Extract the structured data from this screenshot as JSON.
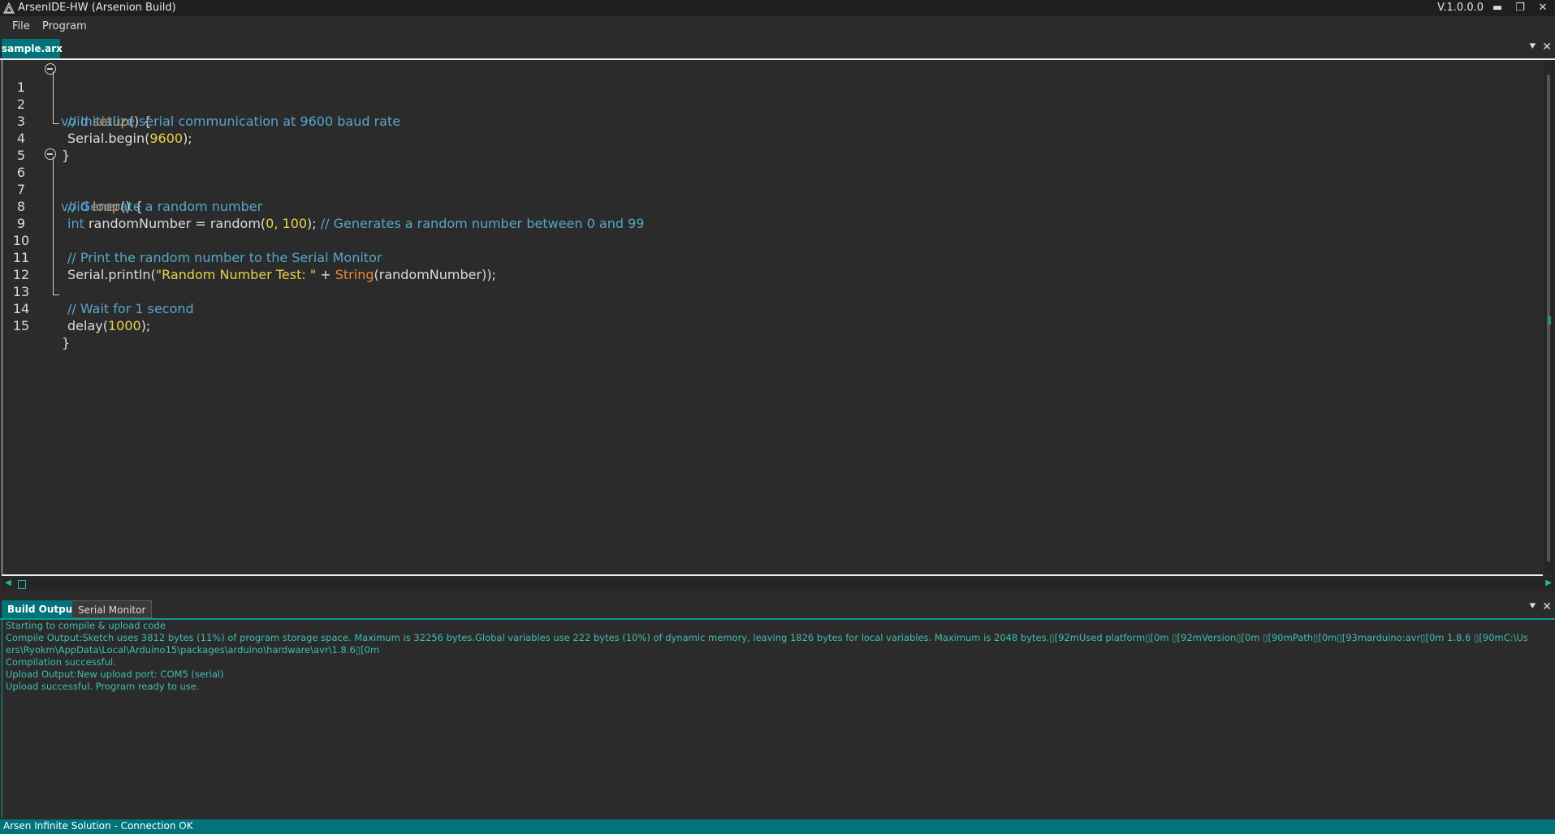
{
  "window": {
    "title": "ArsenIDE-HW (Arsenion Build)",
    "version": "V.1.0.0.0",
    "controls": {
      "minimize": "▬",
      "restore": "❐",
      "close": "✕"
    }
  },
  "menu": {
    "items": [
      {
        "label": "File"
      },
      {
        "label": "Program"
      }
    ]
  },
  "editor": {
    "tab_label": "sample.arx",
    "line_numbers": [
      "1",
      "2",
      "3",
      "4",
      "5",
      "6",
      "7",
      "8",
      "9",
      "10",
      "11",
      "12",
      "13",
      "14",
      "15"
    ]
  },
  "code_tokens": {
    "l1": [
      "void",
      " ",
      "setup",
      "() {"
    ],
    "l2": [
      "// Initialize serial communication at 9600 baud rate"
    ],
    "l3": [
      "Serial.begin(",
      "9600",
      ");"
    ],
    "l4": [
      "}"
    ],
    "l6": [
      "void",
      " ",
      "loop",
      "() {"
    ],
    "l7": [
      "// Generate a random number"
    ],
    "l8": [
      "int",
      " randomNumber = random(",
      "0, 100",
      "); ",
      "// Generates a random number between 0 and 99"
    ],
    "l10": [
      "// Print the random number to the Serial Monitor"
    ],
    "l11": [
      "Serial.println(",
      "\"Random Number Test: \"",
      " + ",
      "String",
      "(randomNumber));"
    ],
    "l13": [
      "// Wait for 1 second"
    ],
    "l14": [
      "delay(",
      "1000",
      ");"
    ],
    "l15": [
      "}"
    ]
  },
  "panel_controls": {
    "dropdown": "⯆",
    "close": "✕"
  },
  "scroll": {
    "left_arrow": "◀",
    "right_arrow": "▶"
  },
  "output": {
    "tabs": [
      {
        "label": "Build Output"
      },
      {
        "label": "Serial Monitor"
      }
    ],
    "lines": [
      "Starting to compile & upload code",
      "Compile Output:Sketch uses 3812 bytes (11%) of program storage space. Maximum is 32256 bytes.Global variables use 222 bytes (10%) of dynamic memory, leaving 1826 bytes for local variables. Maximum is 2048 bytes.▯[92mUsed platform▯[0m ▯[92mVersion▯[0m ▯[90mPath▯[0m▯[93marduino:avr▯[0m   1.8.6   ▯[90mC:\\Users\\Ryokm\\AppData\\Local\\Arduino15\\packages\\arduino\\hardware\\avr\\1.8.6▯[0m",
      "Compilation successful.",
      "Upload Output:New upload port: COM5 (serial)",
      "Upload successful. Program ready to use."
    ]
  },
  "status": {
    "text": "Arsen Infinite Solution - Connection OK"
  },
  "colors": {
    "accent": "#00747a",
    "keyword": "#569cd6",
    "function": "#e8893c",
    "number": "#e8d24c",
    "comment": "#57a6c9",
    "output_text": "#3fbfb0"
  }
}
